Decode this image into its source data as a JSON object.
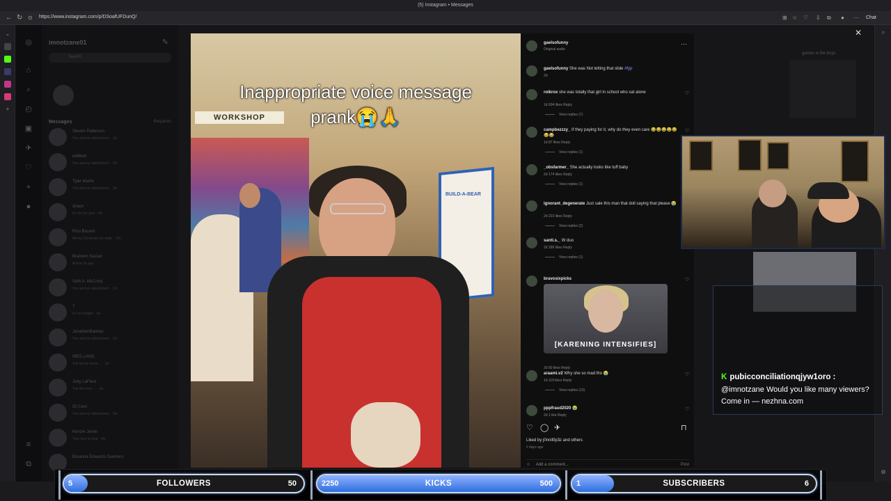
{
  "browser": {
    "tab_title": "(5) Instagram • Messages",
    "url": "https://www.instagram.com/p/DSoafUFDunQ/",
    "chat_label": "Chat"
  },
  "dm": {
    "username": "imnotzane01",
    "search_placeholder": "Search",
    "messages_header": "Messages",
    "requests_label": "Requests",
    "threads": [
      {
        "name": "Steven Patterson",
        "preview": "You sent an attachment. · 3d"
      },
      {
        "name": "wildboh",
        "preview": "You sent an attachment. · 3d"
      },
      {
        "name": "Tyler Martin",
        "preview": "You sent an attachment. · 3d"
      },
      {
        "name": "shaun",
        "preview": "It's fire for you! · 4d"
      },
      {
        "name": "Rico Bozant",
        "preview": "Merry Christmas my dude · 11h"
      },
      {
        "name": "Brandon Sasser",
        "preview": "Active 1h ago"
      },
      {
        "name": "Seth A. McCrory",
        "preview": "You sent an attachment. · 1d"
      },
      {
        "name": "T",
        "preview": "It's on tonight · 1w"
      },
      {
        "name": "JonathanBarkley",
        "preview": "You sent an attachment. · 2d"
      },
      {
        "name": "WES LANG",
        "preview": "You let me know ... · 1w"
      },
      {
        "name": "Joey LaFleur",
        "preview": "You the man ... · 1w"
      },
      {
        "name": "50 Cent",
        "preview": "You sent an attachment. · 4w"
      },
      {
        "name": "Kenzie Joiner",
        "preview": "Your turn to chat · 4w"
      },
      {
        "name": "Breanna Edwards Guerrero",
        "preview": ""
      }
    ]
  },
  "post": {
    "author": "gaelsofunny",
    "audio": "Original audio",
    "caption": "She was Not letting that slide",
    "caption_tag": "#fyp",
    "caption_age": "2d",
    "video_caption_line1": "Inappropriate voice message",
    "video_caption_line2": "prank😭🙏",
    "store_sign": "WORKSHOP",
    "poster_text": "BUILD-A-BEAR",
    "comments": [
      {
        "user": "roikrox",
        "text": "she was totally that girl in school who sat alone",
        "meta": "1d   604 likes   Reply",
        "replies": "View replies (7)"
      },
      {
        "user": "campbezzzy_",
        "text": "If they paying for it, why do they even care 😂😂😂😂😂😂😂",
        "meta": "1d   87 likes   Reply",
        "replies": "View replies (1)"
      },
      {
        "user": "_obsfarmer_",
        "text": "She actually looks like tuff baby",
        "meta": "2d   174 likes   Reply",
        "replies": "View replies (1)"
      },
      {
        "user": "ignorant_degenerate",
        "text": "Just sale this man that doll saying that please 😭",
        "meta": "2d   223 likes   Reply",
        "replies": "View replies (2)"
      },
      {
        "user": "santi.s._",
        "text": "W duo",
        "meta": "2d   399 likes   Reply",
        "replies": "View replies (1)"
      },
      {
        "user": "bravosixpicks",
        "text": "",
        "meta": "2d   60 likes   Reply",
        "replies": ""
      },
      {
        "user": "araami.v2",
        "text": "Why she so mad tho 😭",
        "meta": "1d   119 likes   Reply",
        "replies": "View replies (10)"
      },
      {
        "user": "pppfraud2020",
        "text": "😭",
        "meta": "2d   1 like   Reply",
        "replies": ""
      }
    ],
    "gif_text": "[KARENING INTENSIFIES]",
    "liked_by": "Liked by j0nnil0p3z and others",
    "posted_ago": "2 days ago",
    "add_comment_placeholder": "Add a comment...",
    "post_label": "Post"
  },
  "side": {
    "games_title": "games w the boys"
  },
  "chat": {
    "username": "pubicconciliationqjyw1oro :",
    "message": "@imnotzane Would you like many viewers? Come in — nezhna.com",
    "platform_icon": "K"
  },
  "goals": [
    {
      "label": "FOLLOWERS",
      "current": "5",
      "target": "50",
      "progress": 0.1
    },
    {
      "label": "KICKS",
      "current": "2250",
      "target": "500",
      "progress": 1.0
    },
    {
      "label": "SUBSCRIBERS",
      "current": "1",
      "target": "6",
      "progress": 0.17
    }
  ],
  "colors": {
    "kick_green": "#53fc18",
    "goal_fill": "#2f6fe0",
    "apron_red": "#c9312f"
  }
}
